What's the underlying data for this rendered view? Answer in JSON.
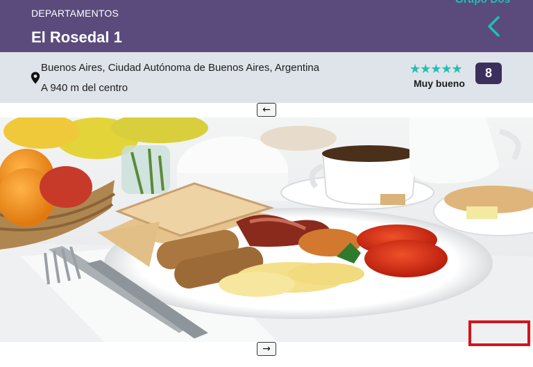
{
  "header": {
    "logo_text": "Grupo Dos",
    "category": "DEPARTAMENTOS",
    "title": "El Rosedal 1",
    "back_icon": "chevron-left-icon"
  },
  "location": {
    "pin_icon": "map-pin-icon",
    "address": "Buenos Aires, Ciudad Autónoma de Buenos Aires, Argentina",
    "distance": "A 940 m del centro"
  },
  "rating": {
    "stars": "★★★★★",
    "stars_value": 5,
    "label": "Muy bueno",
    "score": "8"
  },
  "gallery": {
    "prev_arrow": "←",
    "next_arrow": "→"
  },
  "colors": {
    "header_bg": "#5b4b7c",
    "info_bg": "#dfe3ea",
    "accent": "#1fc0b3",
    "score_bg": "#3b2f5c",
    "highlight": "#d4141c"
  }
}
